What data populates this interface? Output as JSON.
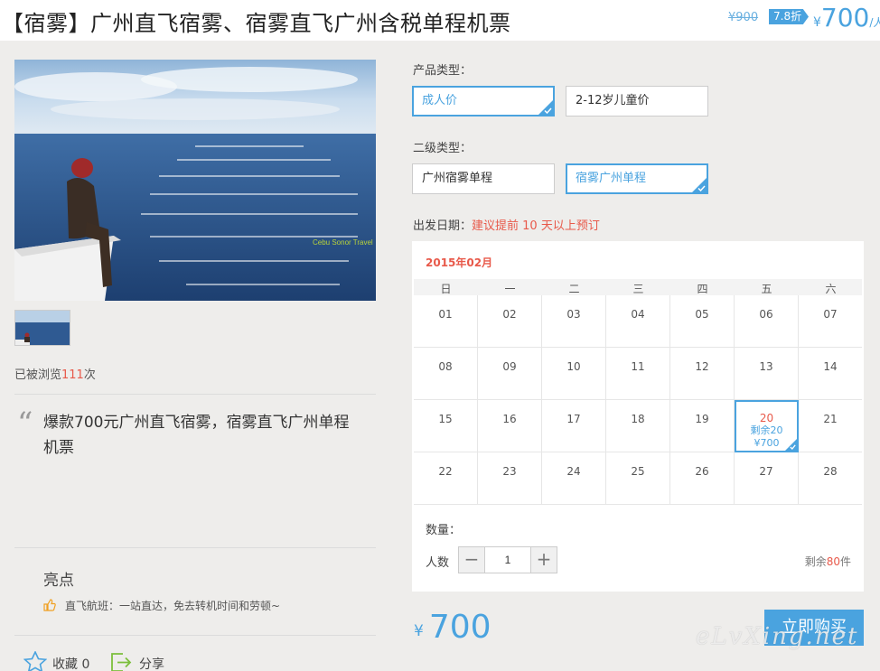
{
  "header": {
    "title": "【宿雾】广州直飞宿雾、宿雾直飞广州含税单程机票",
    "original_price": "¥900",
    "discount": "7.8折",
    "price_symbol": "¥",
    "price": "700",
    "price_unit": "/人"
  },
  "gallery": {
    "logo_text": "Cebu Sonor Travel"
  },
  "stats": {
    "views_prefix": "已被浏览",
    "views_count": "111",
    "views_suffix": "次"
  },
  "summary": "爆款700元广州直飞宿雾，宿雾直飞广州单程机票",
  "highlights": {
    "title": "亮点",
    "items": [
      {
        "label": "直飞航班：一站直达，免去转机时间和劳顿~"
      }
    ]
  },
  "actions": {
    "favorite_label": "收藏 0",
    "share_label": "分享"
  },
  "product_type": {
    "label": "产品类型：",
    "options": [
      {
        "label": "成人价",
        "selected": true
      },
      {
        "label": "2-12岁儿童价",
        "selected": false
      }
    ]
  },
  "sub_type": {
    "label": "二级类型：",
    "options": [
      {
        "label": "广州宿雾单程",
        "selected": false
      },
      {
        "label": "宿雾广州单程",
        "selected": true
      }
    ]
  },
  "departure": {
    "label": "出发日期：",
    "hint": "建议提前 10 天以上预订"
  },
  "calendar": {
    "month": "2015年02月",
    "weekdays": [
      "日",
      "一",
      "二",
      "三",
      "四",
      "五",
      "六"
    ],
    "weeks": [
      [
        "01",
        "02",
        "03",
        "04",
        "05",
        "06",
        "07"
      ],
      [
        "08",
        "09",
        "10",
        "11",
        "12",
        "13",
        "14"
      ],
      [
        "15",
        "16",
        "17",
        "18",
        "19",
        "20",
        "21"
      ],
      [
        "22",
        "23",
        "24",
        "25",
        "26",
        "27",
        "28"
      ]
    ],
    "selected": {
      "day": "20",
      "remaining": "剩余20",
      "price": "¥700"
    }
  },
  "quantity": {
    "label": "数量：",
    "people_label": "人数",
    "minus": "−",
    "plus": "+",
    "value": "1",
    "remaining_prefix": "剩余",
    "remaining_count": "80",
    "remaining_suffix": "件"
  },
  "footer": {
    "price_symbol": "¥",
    "price": "700",
    "buy_label": "立即购买",
    "watermark": "eLvXing.net"
  },
  "colors": {
    "accent": "#4aa3df",
    "highlight": "#e8594a",
    "background": "#eeedeb"
  }
}
